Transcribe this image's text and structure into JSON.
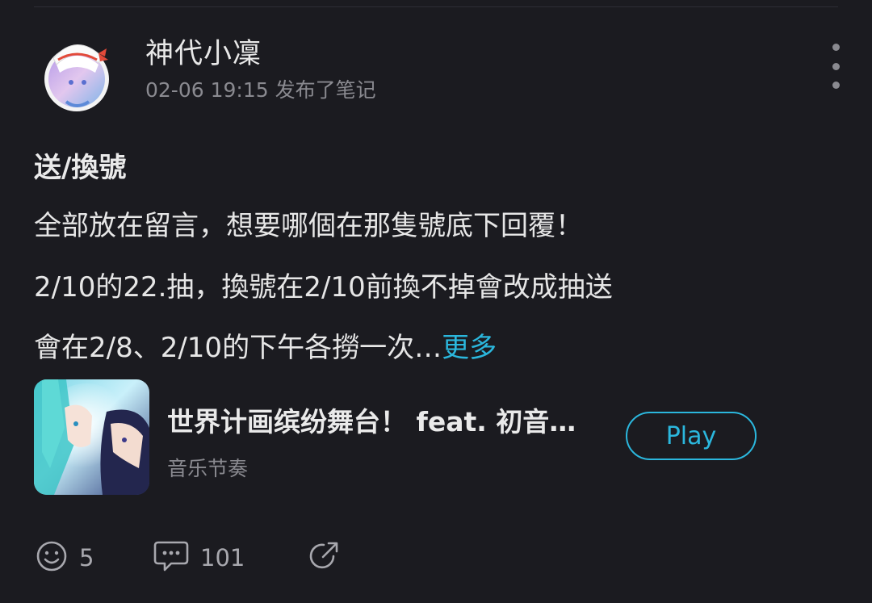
{
  "post": {
    "author": "神代小凜",
    "meta": "02-06 19:15 发布了笔记",
    "title": "送/換號",
    "lines": [
      "全部放在留言，想要哪個在那隻號底下回覆！",
      "2/10的22.抽，換號在2/10前換不掉會改成抽送",
      "會在2/8、2/10的下午各撈一次…"
    ],
    "more_label": "更多"
  },
  "game_card": {
    "title": "世界计画缤纷舞台！ feat. 初音…",
    "category": "音乐节奏",
    "play_label": "Play"
  },
  "actions": {
    "like_count": "5",
    "comment_count": "101"
  },
  "colors": {
    "background": "#1b1b20",
    "accent": "#2bb7dd",
    "muted": "#8a8a90"
  },
  "icons": [
    "more-vertical-icon",
    "smiley-icon",
    "comment-icon",
    "share-icon"
  ]
}
